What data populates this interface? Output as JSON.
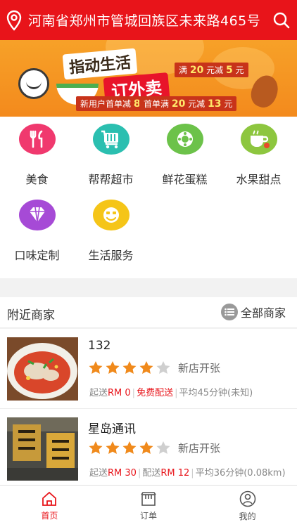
{
  "header": {
    "address": "河南省郑州市管城回族区未来路465号"
  },
  "banner": {
    "title_line1": "指动生活",
    "title_line2": "订外卖",
    "promo_new_prefix": "新用户首单减",
    "promo_new_value": "8",
    "promo_new_unit": "元",
    "promo_first_prefix": "首单满",
    "promo_first_threshold": "20",
    "promo_first_mid": "元减",
    "promo_first_value": "13",
    "promo_first_unit": "元",
    "promo_top_prefix": "满",
    "promo_top_threshold": "20",
    "promo_top_mid": "元减",
    "promo_top_value": "5",
    "promo_top_unit": "元"
  },
  "categories": [
    {
      "label": "美食",
      "icon": "food-icon",
      "color": "#f0396e"
    },
    {
      "label": "帮帮超市",
      "icon": "cart-icon",
      "color": "#2bbfb0"
    },
    {
      "label": "鲜花蛋糕",
      "icon": "flower-icon",
      "color": "#6cc24a"
    },
    {
      "label": "水果甜点",
      "icon": "cup-icon",
      "color": "#8dc63f"
    },
    {
      "label": "口味定制",
      "icon": "diamond-icon",
      "color": "#a64ad6"
    },
    {
      "label": "生活服务",
      "icon": "smile-icon",
      "color": "#f5c518"
    }
  ],
  "nearby": {
    "title": "附近商家",
    "all_label": "全部商家"
  },
  "shops": [
    {
      "name": "132",
      "rating": 4,
      "max_rating": 5,
      "status": "新店开张",
      "min_label": "起送",
      "min_value": "RM 0",
      "delivery_text": "免费配送",
      "avg_text": "平均45分钟(未知)"
    },
    {
      "name": "星岛通讯",
      "rating": 4,
      "max_rating": 5,
      "status": "新店开张",
      "min_label": "起送",
      "min_value": "RM 30",
      "delivery_label": "配送",
      "delivery_value": "RM 12",
      "avg_text": "平均36分钟(0.08km)"
    }
  ],
  "tabs": [
    {
      "label": "首页",
      "icon": "home-icon",
      "active": true
    },
    {
      "label": "订单",
      "icon": "order-icon",
      "active": false
    },
    {
      "label": "我的",
      "icon": "user-icon",
      "active": false
    }
  ],
  "colors": {
    "brand_red": "#e8141a",
    "star": "#f08a1c",
    "star_off": "#cfcfcf"
  }
}
